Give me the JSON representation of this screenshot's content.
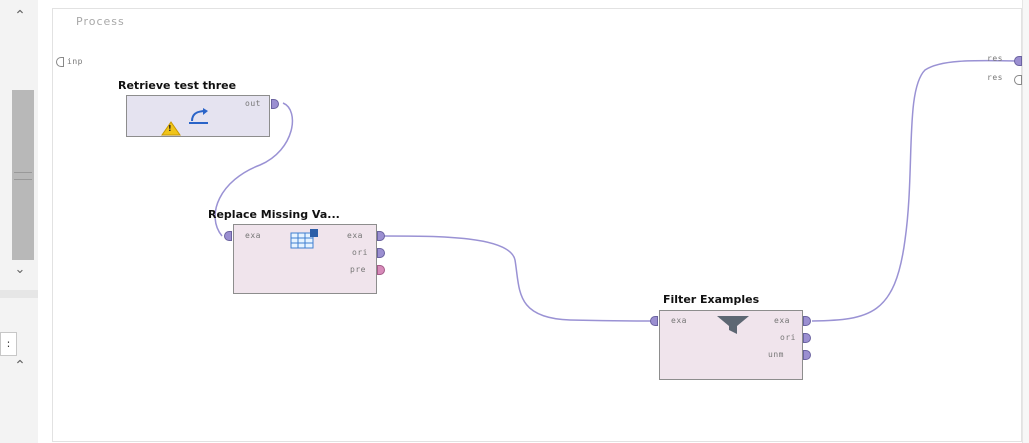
{
  "canvas": {
    "title": "Process"
  },
  "process_ports": {
    "input": "inp",
    "outputs": [
      "res",
      "res"
    ]
  },
  "operators": {
    "retrieve": {
      "title": "Retrieve test three",
      "ports_out": [
        "out"
      ],
      "warning": "!"
    },
    "replace": {
      "title": "Replace Missing Va...",
      "ports_in": [
        "exa"
      ],
      "ports_out": [
        "exa",
        "ori",
        "pre"
      ]
    },
    "filter": {
      "title": "Filter Examples",
      "ports_in": [
        "exa"
      ],
      "ports_out": [
        "exa",
        "ori",
        "unm"
      ]
    }
  },
  "left_panel": {
    "box_text": ":"
  },
  "colors": {
    "wire": "#9a92d4",
    "port_purple": "#9b8fd1",
    "port_pink": "#d78ab9",
    "op_purple": "#e5e3f0",
    "op_pink": "#f0e4ec"
  }
}
